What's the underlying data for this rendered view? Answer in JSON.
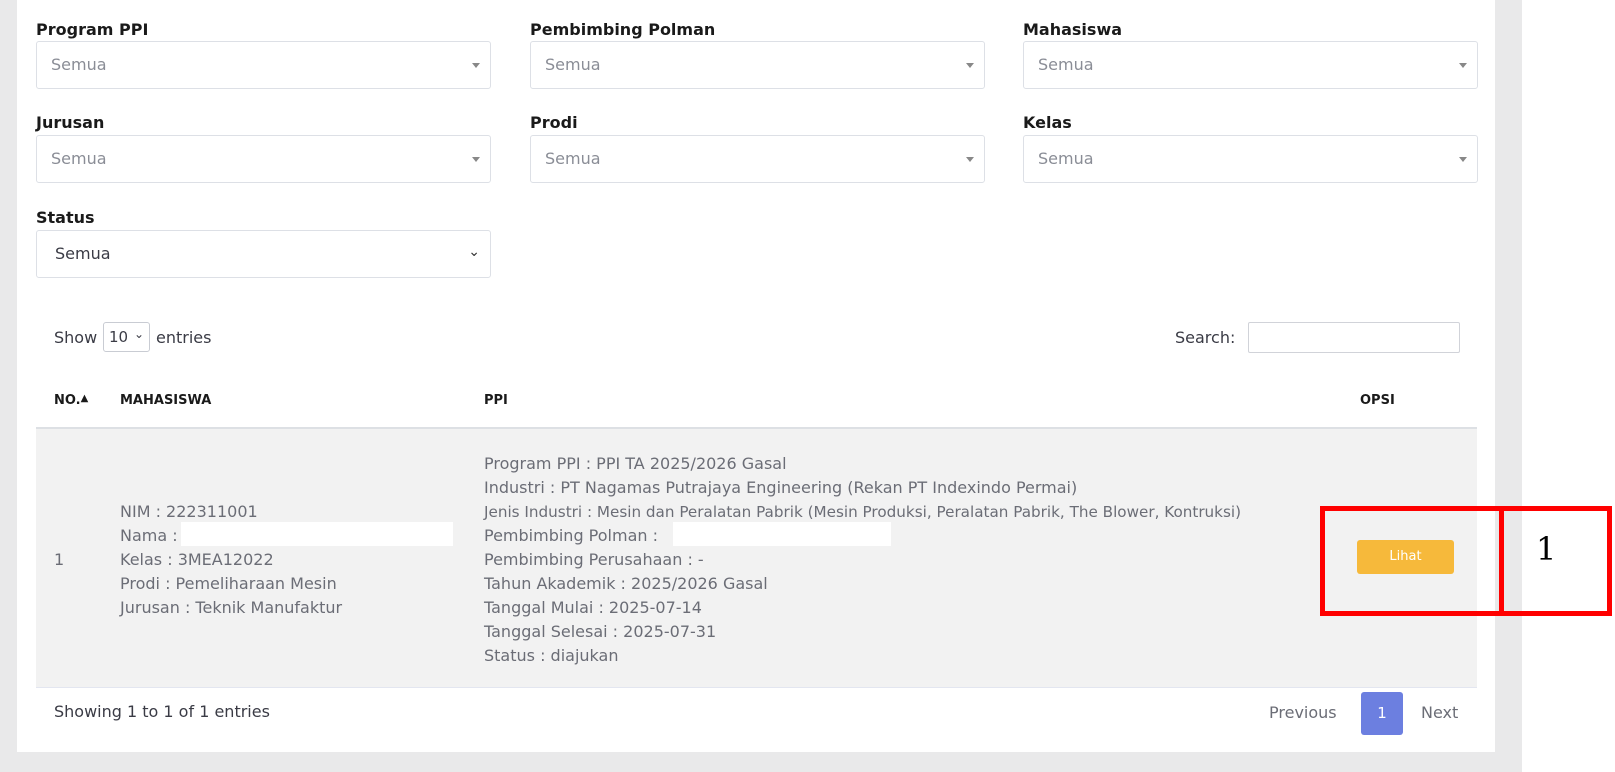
{
  "filters": {
    "program_ppi": {
      "label": "Program PPI",
      "value": "Semua"
    },
    "pembimbing_polman": {
      "label": "Pembimbing Polman",
      "value": "Semua"
    },
    "mahasiswa": {
      "label": "Mahasiswa",
      "value": "Semua"
    },
    "jurusan": {
      "label": "Jurusan",
      "value": "Semua"
    },
    "prodi": {
      "label": "Prodi",
      "value": "Semua"
    },
    "kelas": {
      "label": "Kelas",
      "value": "Semua"
    },
    "status": {
      "label": "Status",
      "value": "Semua"
    }
  },
  "table_controls": {
    "show_label": "Show",
    "entries_value": "10",
    "entries_label": "entries",
    "search_label": "Search:"
  },
  "table": {
    "headers": {
      "no": "NO.",
      "mahasiswa": "MAHASISWA",
      "ppi": "PPI",
      "opsi": "OPSI"
    },
    "rows": [
      {
        "no": "1",
        "mahasiswa": [
          "NIM : 222311001",
          "Nama :",
          "Kelas : 3MEA12022",
          "Prodi : Pemeliharaan Mesin",
          "Jurusan : Teknik Manufaktur"
        ],
        "ppi": [
          "Program PPI : PPI TA 2025/2026 Gasal",
          "Industri : PT Nagamas Putrajaya Engineering (Rekan PT Indexindo Permai)",
          "Jenis Industri : Mesin dan Peralatan Pabrik (Mesin Produksi, Peralatan Pabrik, The Blower, Kontruksi)",
          "Pembimbing Polman :",
          "Pembimbing Perusahaan : -",
          "Tahun Akademik : 2025/2026 Gasal",
          "Tanggal Mulai : 2025-07-14",
          "Tanggal Selesai : 2025-07-31",
          "Status : diajukan"
        ],
        "action_label": "Lihat"
      }
    ]
  },
  "footer": {
    "info": "Showing 1 to 1 of 1 entries",
    "previous": "Previous",
    "current_page": "1",
    "next": "Next"
  },
  "annotation": {
    "label": "1",
    "color": "#ff0000"
  },
  "colors": {
    "accent_button": "#f6b93b",
    "page_active": "#6c7fe0"
  }
}
